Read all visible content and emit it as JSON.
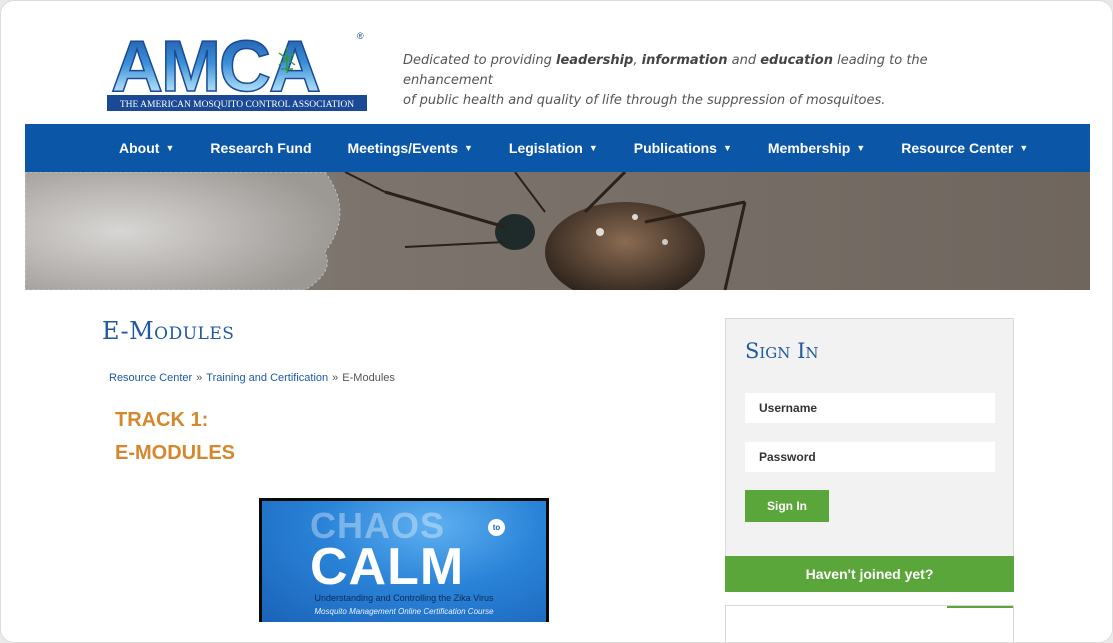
{
  "header": {
    "logo_text": "AMCA",
    "logo_registered": "®",
    "logo_subtitle": "THE AMERICAN MOSQUITO CONTROL ASSOCIATION",
    "tagline": {
      "p1": "Dedicated to providing ",
      "b1": "leadership",
      "p2": ", ",
      "b2": "information",
      "p3": " and ",
      "b3": "education",
      "p4": " leading to the enhancement",
      "line2": "of public health and quality of life through the suppression of mosquitoes."
    }
  },
  "nav": {
    "items": [
      {
        "label": "About",
        "dropdown": true
      },
      {
        "label": "Research Fund",
        "dropdown": false
      },
      {
        "label": "Meetings/Events",
        "dropdown": true
      },
      {
        "label": "Legislation",
        "dropdown": true
      },
      {
        "label": "Publications",
        "dropdown": true
      },
      {
        "label": "Membership",
        "dropdown": true
      },
      {
        "label": "Resource Center",
        "dropdown": true
      }
    ],
    "caret": "▼"
  },
  "main": {
    "title": "E-Modules",
    "breadcrumb": {
      "item1": "Resource Center",
      "item2": "Training and Certification",
      "current": "E-Modules",
      "separator": "»"
    },
    "track_line1": "TRACK 1:",
    "track_line2": "E-MODULES",
    "course": {
      "word1": "CHAOS",
      "to": "to",
      "word2": "CALM",
      "subtitle": "Understanding and Controlling the Zika Virus",
      "subtitle2": "Mosquito Management Online Certification Course"
    }
  },
  "sidebar": {
    "title": "Sign In",
    "username_placeholder": "Username",
    "password_placeholder": "Password",
    "signin_button": "Sign In",
    "join_prompt": "Haven't joined yet?"
  },
  "colors": {
    "nav_bg": "#0b56a6",
    "title_blue": "#1f5aa0",
    "track_orange": "#d4872d",
    "green": "#5ba63b"
  }
}
